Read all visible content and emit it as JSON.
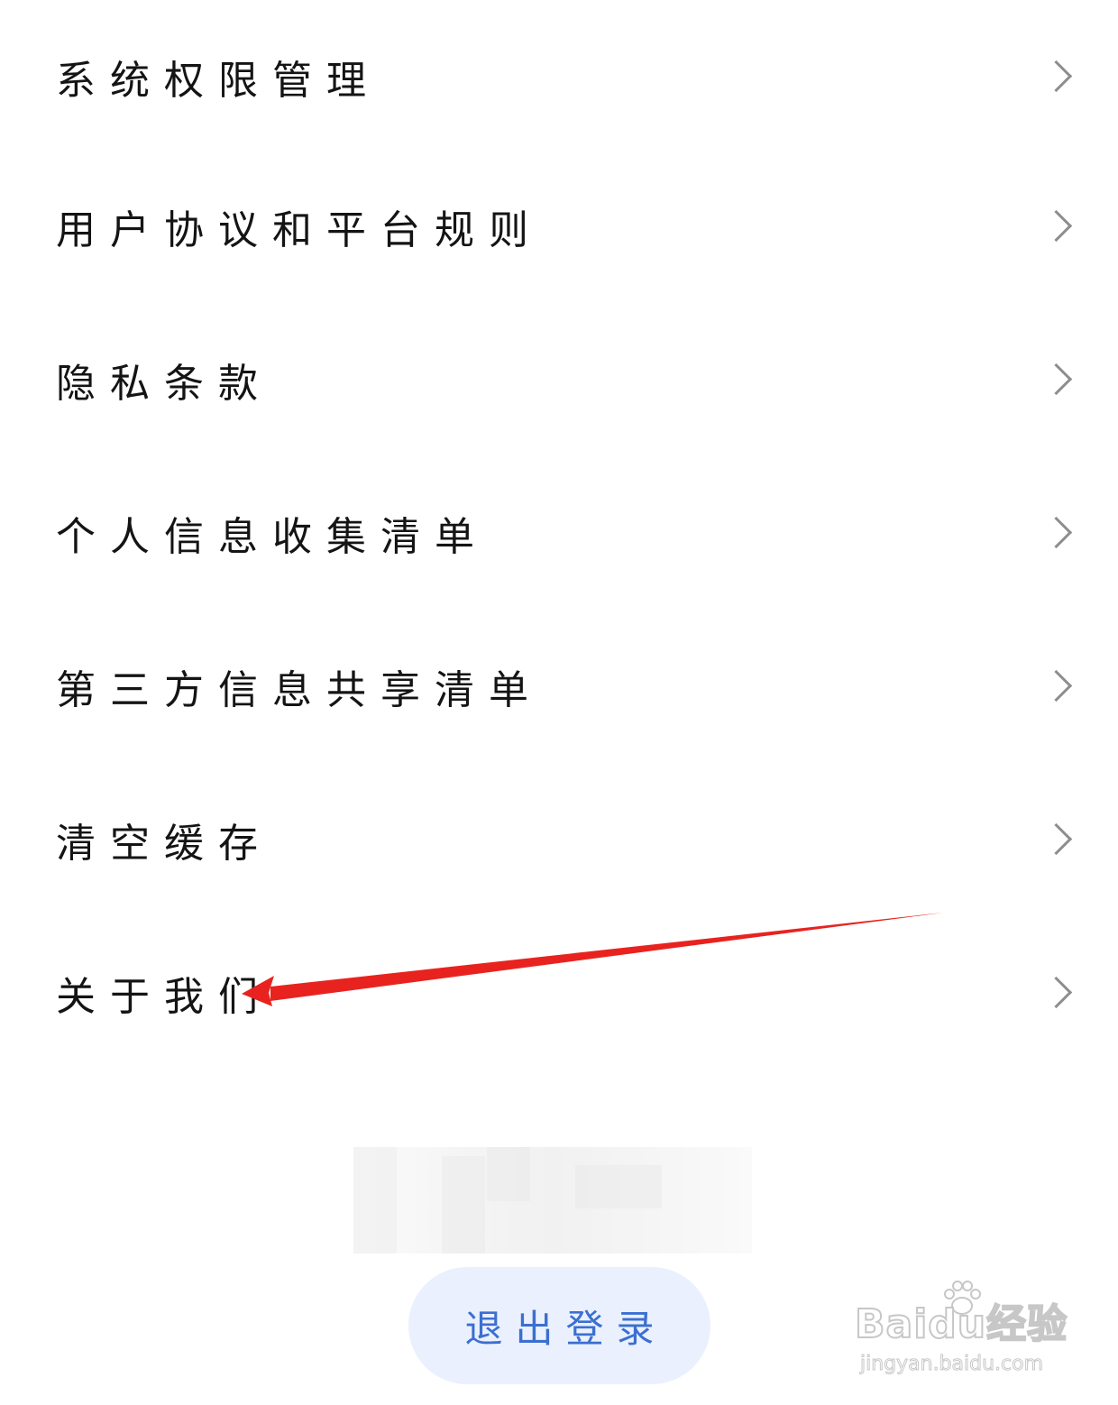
{
  "menu": {
    "items": [
      {
        "label": "系统权限管理",
        "chevron_icon": "chevron-right-icon"
      },
      {
        "label": "用户协议和平台规则",
        "chevron_icon": "chevron-right-icon"
      },
      {
        "label": "隐私条款",
        "chevron_icon": "chevron-right-icon"
      },
      {
        "label": "个人信息收集清单",
        "chevron_icon": "chevron-right-icon"
      },
      {
        "label": "第三方信息共享清单",
        "chevron_icon": "chevron-right-icon"
      },
      {
        "label": "清空缓存",
        "chevron_icon": "chevron-right-icon"
      },
      {
        "label": "关于我们",
        "chevron_icon": "chevron-right-icon"
      }
    ]
  },
  "logout": {
    "label": "退出登录"
  },
  "annotation": {
    "arrow_color": "#e8231f"
  },
  "watermark": {
    "brand": "Baidu经验",
    "url": "jingyan.baidu.com"
  },
  "colors": {
    "text": "#141414",
    "chevron": "#8e8e8e",
    "logout_bg": "#eaf0fd",
    "logout_text": "#3b6fd0"
  }
}
